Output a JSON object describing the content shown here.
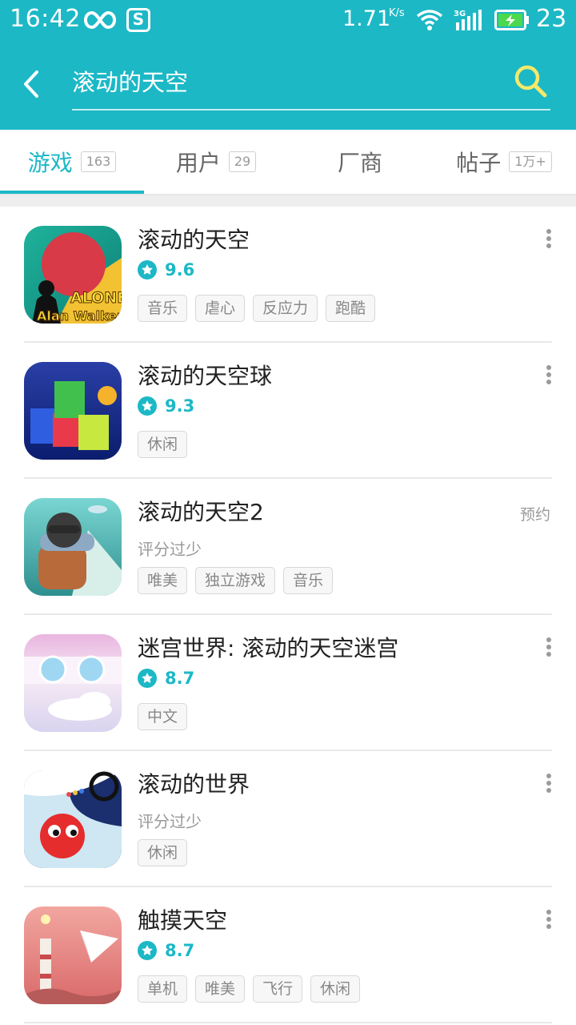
{
  "status_bar": {
    "time": "16:42",
    "speed": "1.71",
    "speed_unit": "K/s",
    "network": "3G",
    "battery": "23",
    "icons": [
      "infinity-icon",
      "s-app-icon",
      "wifi-icon",
      "signal-icon",
      "battery-charging-icon"
    ]
  },
  "search": {
    "query": "滚动的天空",
    "back_icon": "back-arrow-icon",
    "search_icon": "search-icon"
  },
  "tabs": [
    {
      "label": "游戏",
      "count": "163",
      "active": true
    },
    {
      "label": "用户",
      "count": "29",
      "active": false
    },
    {
      "label": "厂商",
      "count": "",
      "active": false
    },
    {
      "label": "帖子",
      "count": "1万+",
      "active": false
    }
  ],
  "results": [
    {
      "title": "滚动的天空",
      "score": "9.6",
      "low_score": "",
      "action": "",
      "tags": [
        "音乐",
        "虐心",
        "反应力",
        "跑酷"
      ],
      "icon_logo_text": [
        "ALONE",
        "Alan Walker"
      ]
    },
    {
      "title": "滚动的天空球",
      "score": "9.3",
      "low_score": "",
      "action": "",
      "tags": [
        "休闲"
      ]
    },
    {
      "title": "滚动的天空2",
      "score": "",
      "low_score": "评分过少",
      "action": "预约",
      "tags": [
        "唯美",
        "独立游戏",
        "音乐"
      ]
    },
    {
      "title": "迷宫世界: 滚动的天空迷宫",
      "score": "8.7",
      "low_score": "",
      "action": "",
      "tags": [
        "中文"
      ]
    },
    {
      "title": "滚动的世界",
      "score": "",
      "low_score": "评分过少",
      "action": "",
      "tags": [
        "休闲"
      ]
    },
    {
      "title": "触摸天空",
      "score": "8.7",
      "low_score": "",
      "action": "",
      "tags": [
        "单机",
        "唯美",
        "飞行",
        "休闲"
      ]
    }
  ],
  "colors": {
    "accent": "#1cb8c6",
    "star": "#1cb8c6",
    "search_icon": "#f5e96a"
  }
}
